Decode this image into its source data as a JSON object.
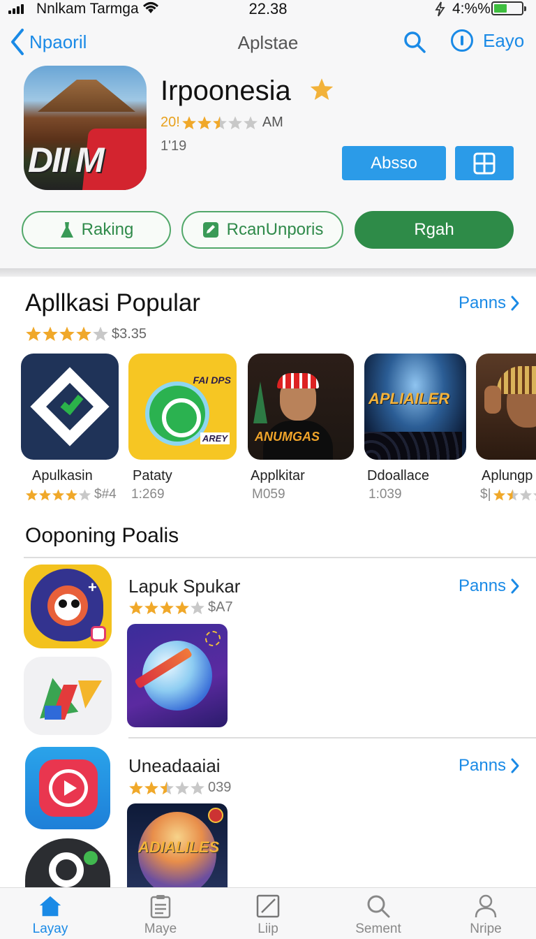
{
  "status_bar": {
    "carrier": "Nnlkam Tarmga",
    "time": "22.38",
    "battery": "4:%%"
  },
  "nav": {
    "back_label": "Npaoril",
    "title": "Aplstae",
    "info_label": "Eayo"
  },
  "app": {
    "name": "Irpoonesia",
    "rating_prefix": "20!",
    "rating_stars": 2.5,
    "rating_suffix": "AM",
    "size": "1'19",
    "icon_text": "DII",
    "icon_badge_text": "M",
    "install_label": "Absso",
    "actions": [
      {
        "label": "Raking",
        "icon": "person-icon"
      },
      {
        "label": "RcanUnporis",
        "icon": "edit-square-icon"
      },
      {
        "label": "Rgah"
      }
    ]
  },
  "popular": {
    "title": "Apllkasi Popular",
    "more_label": "Panns",
    "rating_stars": 4,
    "price": "$3.35",
    "apps": [
      {
        "name": "Apulkasin",
        "stars": 4,
        "meta": "$#4"
      },
      {
        "name": "Pataty",
        "meta": "1:269",
        "icon_text_top": "FAI DPS",
        "icon_text_bottom": "AREY"
      },
      {
        "name": "Applkitar",
        "meta": "M059",
        "icon_text": "ANUMGAS"
      },
      {
        "name": "Ddoallace",
        "meta": "1:039",
        "icon_text": "APLIAILER"
      },
      {
        "name": "Aplungp",
        "stars": 1.5,
        "meta": "$|"
      }
    ]
  },
  "upcoming": {
    "title": "Ooponing Poalis",
    "rows": [
      {
        "name": "Lapuk Spukar",
        "stars": 4,
        "price": "$A7",
        "more_label": "Panns"
      },
      {
        "name": "Uneadaaiai",
        "stars": 2.5,
        "price": "039",
        "more_label": "Panns",
        "icon_text": "ADIALILES"
      }
    ]
  },
  "tabs": [
    {
      "label": "Layay",
      "icon": "home-icon",
      "active": true
    },
    {
      "label": "Maye",
      "icon": "clipboard-icon"
    },
    {
      "label": "Liip",
      "icon": "edit-icon"
    },
    {
      "label": "Sement",
      "icon": "search-icon"
    },
    {
      "label": "Nripe",
      "icon": "profile-icon"
    }
  ],
  "colors": {
    "accent": "#1a8ae6",
    "install": "#2b9be8",
    "green": "#2e8b48",
    "star": "#f0a829",
    "star_empty": "#c8c8c8"
  }
}
